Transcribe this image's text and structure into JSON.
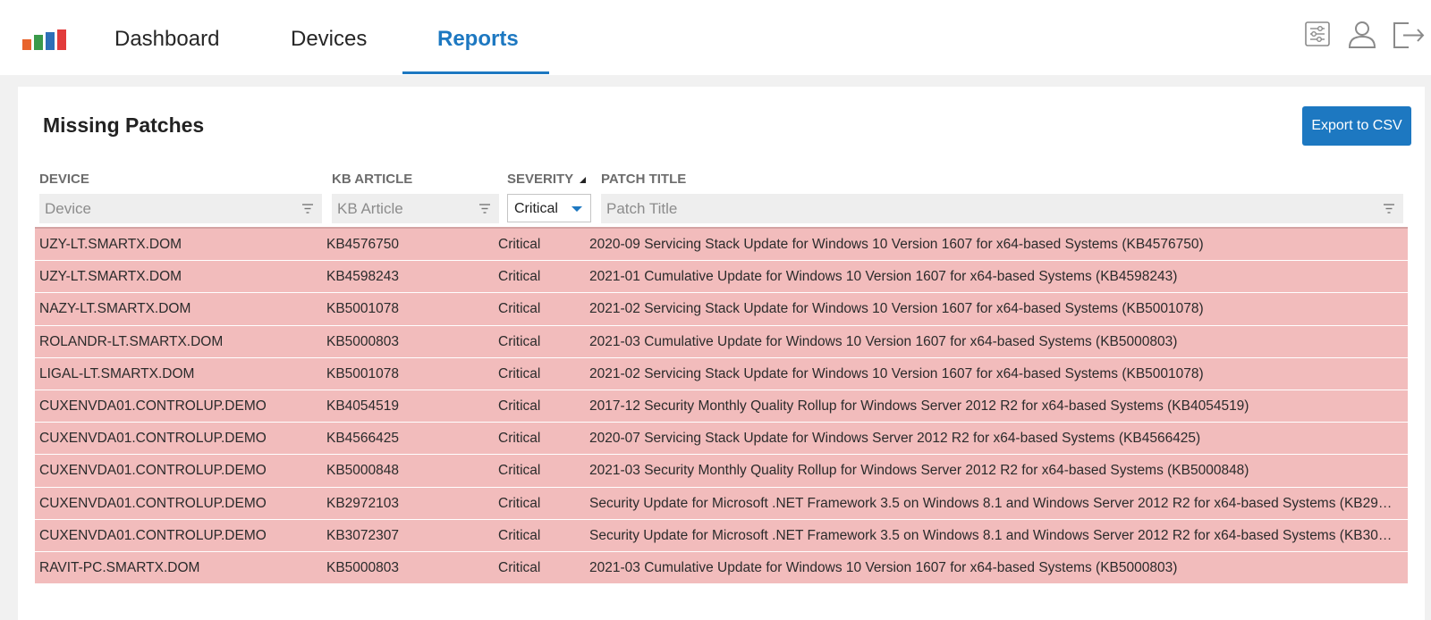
{
  "brand": {
    "logo_colors": [
      "#e8642c",
      "#3a9a4a",
      "#2d6fb7",
      "#e23b3b"
    ]
  },
  "nav": {
    "tabs": [
      {
        "label": "Dashboard"
      },
      {
        "label": "Devices"
      },
      {
        "label": "Reports",
        "active": true
      }
    ],
    "icons": [
      "settings-sliders-icon",
      "user-icon",
      "logout-icon"
    ]
  },
  "panel": {
    "title": "Missing Patches",
    "export_label": "Export to CSV"
  },
  "columns": {
    "device": {
      "header": "DEVICE",
      "placeholder": "Device"
    },
    "kb": {
      "header": "KB ARTICLE",
      "placeholder": "KB Article"
    },
    "severity": {
      "header": "SEVERITY",
      "filter_value": "Critical",
      "sorted": "descending"
    },
    "title": {
      "header": "PATCH TITLE",
      "placeholder": "Patch Title"
    }
  },
  "rows": [
    {
      "device": "UZY-LT.SMARTX.DOM",
      "kb": "KB4576750",
      "severity": "Critical",
      "title": "2020-09 Servicing Stack Update for Windows 10 Version 1607 for x64-based Systems (KB4576750)"
    },
    {
      "device": "UZY-LT.SMARTX.DOM",
      "kb": "KB4598243",
      "severity": "Critical",
      "title": "2021-01 Cumulative Update for Windows 10 Version 1607 for x64-based Systems (KB4598243)"
    },
    {
      "device": "NAZY-LT.SMARTX.DOM",
      "kb": "KB5001078",
      "severity": "Critical",
      "title": "2021-02 Servicing Stack Update for Windows 10 Version 1607 for x64-based Systems (KB5001078)"
    },
    {
      "device": "ROLANDR-LT.SMARTX.DOM",
      "kb": "KB5000803",
      "severity": "Critical",
      "title": "2021-03 Cumulative Update for Windows 10 Version 1607 for x64-based Systems (KB5000803)"
    },
    {
      "device": "LIGAL-LT.SMARTX.DOM",
      "kb": "KB5001078",
      "severity": "Critical",
      "title": "2021-02 Servicing Stack Update for Windows 10 Version 1607 for x64-based Systems (KB5001078)"
    },
    {
      "device": "CUXENVDA01.CONTROLUP.DEMO",
      "kb": "KB4054519",
      "severity": "Critical",
      "title": "2017-12 Security Monthly Quality Rollup for Windows Server 2012 R2 for x64-based Systems (KB4054519)"
    },
    {
      "device": "CUXENVDA01.CONTROLUP.DEMO",
      "kb": "KB4566425",
      "severity": "Critical",
      "title": "2020-07 Servicing Stack Update for Windows Server 2012 R2 for x64-based Systems (KB4566425)"
    },
    {
      "device": "CUXENVDA01.CONTROLUP.DEMO",
      "kb": "KB5000848",
      "severity": "Critical",
      "title": "2021-03 Security Monthly Quality Rollup for Windows Server 2012 R2 for x64-based Systems (KB5000848)"
    },
    {
      "device": "CUXENVDA01.CONTROLUP.DEMO",
      "kb": "KB2972103",
      "severity": "Critical",
      "title": "Security Update for Microsoft .NET Framework 3.5 on Windows 8.1 and Windows Server 2012 R2 for x64-based Systems (KB29…"
    },
    {
      "device": "CUXENVDA01.CONTROLUP.DEMO",
      "kb": "KB3072307",
      "severity": "Critical",
      "title": "Security Update for Microsoft .NET Framework 3.5 on Windows 8.1 and Windows Server 2012 R2 for x64-based Systems (KB30…"
    },
    {
      "device": "RAVIT-PC.SMARTX.DOM",
      "kb": "KB5000803",
      "severity": "Critical",
      "title": "2021-03 Cumulative Update for Windows 10 Version 1607 for x64-based Systems (KB5000803)"
    }
  ],
  "colors": {
    "accent": "#1d78c1",
    "critical_row": "#f2bcbc"
  }
}
